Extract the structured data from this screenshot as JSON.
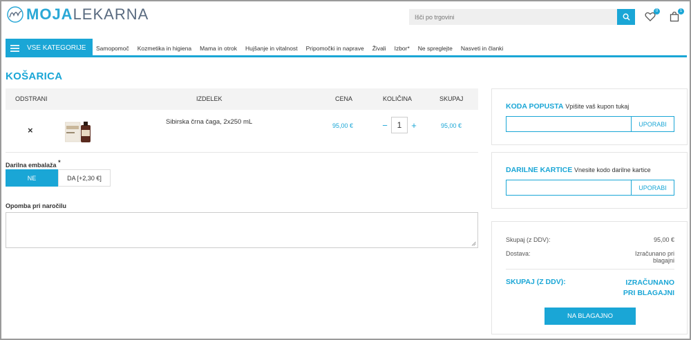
{
  "brand": {
    "logo_bold": "MOJA",
    "logo_light": "LEKARNA",
    "accent": "#1aa6d6"
  },
  "header": {
    "search_placeholder": "Išči po trgovini",
    "wishlist_count": "0",
    "cart_count": "1"
  },
  "nav": {
    "all_categories": "VSE KATEGORIJE",
    "items": [
      "Samopomoč",
      "Kozmetika in higiena",
      "Mama in otrok",
      "Hujšanje in vitalnost",
      "Pripomočki in naprave",
      "Živali",
      "Izbor*",
      "Ne spreglejte",
      "Nasveti in članki"
    ]
  },
  "cart": {
    "title": "KOŠARICA",
    "columns": {
      "remove": "ODSTRANI",
      "product": "IZDELEK",
      "price": "CENA",
      "quantity": "KOLIČINA",
      "total": "SKUPAJ"
    },
    "items": [
      {
        "remove": "×",
        "name": "Sibirska črna čaga, 2x250 mL",
        "price": "95,00 €",
        "quantity": "1",
        "total": "95,00 €",
        "minus": "−",
        "plus": "+"
      }
    ],
    "gift_wrap_label": "Darilna embalaža",
    "gift_wrap_required": "*",
    "gift_wrap_options": [
      "NE",
      "DA [+2,30 €]"
    ],
    "note_label": "Opomba pri naročilu"
  },
  "coupon": {
    "title": "KODA POPUSTA",
    "subtitle": "Vpišite vaš kupon tukaj",
    "button": "UPORABI"
  },
  "giftcard": {
    "title": "DARILNE KARTICE",
    "subtitle": "Vnesite kodo darilne kartice",
    "button": "UPORABI"
  },
  "summary": {
    "subtotal_label": "Skupaj (z DDV):",
    "subtotal_value": "95,00 €",
    "shipping_label": "Dostava:",
    "shipping_value_1": "Izračunano pri",
    "shipping_value_2": "blagajni",
    "total_label": "SKUPAJ (Z DDV):",
    "total_value_1": "IZRAČUNANO",
    "total_value_2": "PRI BLAGAJNI",
    "checkout": "NA BLAGAJNO"
  }
}
